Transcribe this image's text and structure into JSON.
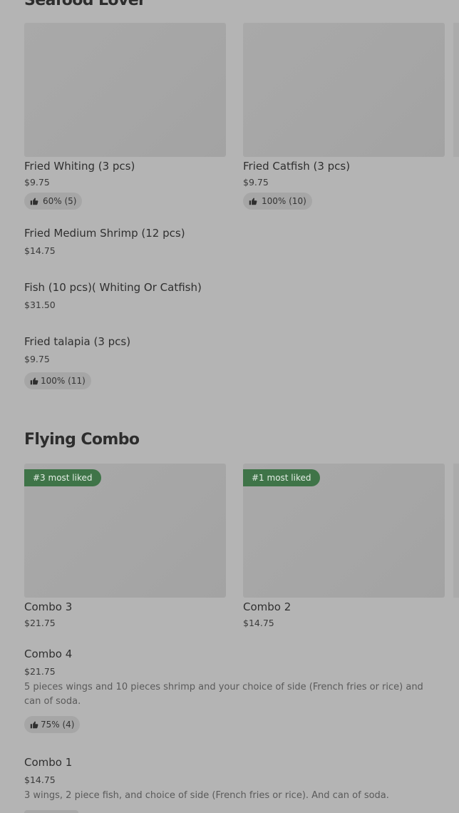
{
  "sections": [
    {
      "title": "Seafood Lover",
      "cards": [
        {
          "name": "Fried Whiting (3 pcs)",
          "price": "$9.75",
          "rating": "60% (5)"
        },
        {
          "name": "Fried Catfish (3 pcs)",
          "price": "$9.75",
          "rating": "100% (10)"
        }
      ],
      "list": [
        {
          "name": "Fried Medium Shrimp (12 pcs)",
          "price": "$14.75"
        },
        {
          "name": "Fish (10 pcs)( Whiting Or Catfish)",
          "price": "$31.50"
        },
        {
          "name": "Fried talapia (3 pcs)",
          "price": "$9.75",
          "rating": "100% (11)"
        }
      ]
    },
    {
      "title": "Flying Combo",
      "cards": [
        {
          "badge": "#3 most liked",
          "name": "Combo 3",
          "price": "$21.75"
        },
        {
          "badge": "#1 most liked",
          "name": "Combo 2",
          "price": "$14.75"
        }
      ],
      "list": [
        {
          "name": "Combo 4",
          "price": "$21.75",
          "description": "5 pieces wings and 10 pieces shrimp and your choice of side (French fries or rice) and can of soda.",
          "rating": "75% (4)"
        },
        {
          "name": "Combo 1",
          "price": "$14.75",
          "description": "3 wings, 2 piece fish, and choice of side (French fries or rice). And can of soda."
        }
      ]
    }
  ],
  "icons": {
    "rating": "thumbs-up-icon"
  },
  "colors": {
    "badge_bg": "#3f7448",
    "overlay_bg": "#b4b4b4"
  }
}
